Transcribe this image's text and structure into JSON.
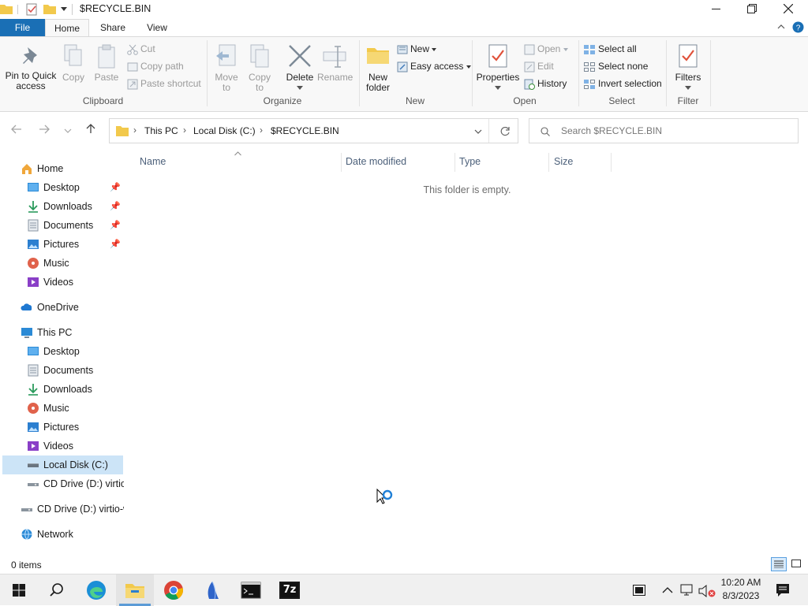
{
  "window": {
    "title": "$RECYCLE.BIN"
  },
  "ribbon_tabs": [
    "File",
    "Home",
    "Share",
    "View"
  ],
  "ribbon": {
    "clipboard": {
      "pin": [
        "Pin to Quick",
        "access"
      ],
      "copy": "Copy",
      "paste": "Paste",
      "cut": "Cut",
      "copy_path": "Copy path",
      "paste_shortcut": "Paste shortcut",
      "label": "Clipboard"
    },
    "organize": {
      "move_to": [
        "Move",
        "to"
      ],
      "copy_to": [
        "Copy",
        "to"
      ],
      "delete": "Delete",
      "rename": "Rename",
      "label": "Organize"
    },
    "new": {
      "new_folder": [
        "New",
        "folder"
      ],
      "new_item": "New",
      "easy_access": "Easy access",
      "label": "New"
    },
    "open": {
      "properties": "Properties",
      "open": "Open",
      "edit": "Edit",
      "history": "History",
      "label": "Open"
    },
    "select": {
      "select_all": "Select all",
      "select_none": "Select none",
      "invert": "Invert selection",
      "label": "Select"
    },
    "filter": {
      "filters": "Filters",
      "label": "Filter"
    }
  },
  "address": {
    "crumbs": [
      "This PC",
      "Local Disk (C:)",
      "$RECYCLE.BIN"
    ]
  },
  "search": {
    "placeholder": "Search $RECYCLE.BIN"
  },
  "nav": {
    "home": "Home",
    "quick": [
      {
        "label": "Desktop",
        "icon": "desktop-icon"
      },
      {
        "label": "Downloads",
        "icon": "downloads-icon"
      },
      {
        "label": "Documents",
        "icon": "documents-icon"
      },
      {
        "label": "Pictures",
        "icon": "pictures-icon"
      },
      {
        "label": "Music",
        "icon": "music-icon"
      },
      {
        "label": "Videos",
        "icon": "videos-icon"
      }
    ],
    "onedrive": "OneDrive",
    "thispc": "This PC",
    "pc_items": [
      {
        "label": "Desktop",
        "icon": "desktop-icon"
      },
      {
        "label": "Documents",
        "icon": "documents-icon"
      },
      {
        "label": "Downloads",
        "icon": "downloads-icon"
      },
      {
        "label": "Music",
        "icon": "music-icon"
      },
      {
        "label": "Pictures",
        "icon": "pictures-icon"
      },
      {
        "label": "Videos",
        "icon": "videos-icon"
      },
      {
        "label": "Local Disk (C:)",
        "icon": "drive-icon"
      },
      {
        "label": "CD Drive (D:) virtio-",
        "icon": "cd-drive-icon"
      }
    ],
    "cd_drive": "CD Drive (D:) virtio-w",
    "network": "Network"
  },
  "columns": [
    "Name",
    "Date modified",
    "Type",
    "Size"
  ],
  "empty_message": "This folder is empty.",
  "status": {
    "items": "0 items"
  },
  "taskbar": {
    "time": "10:20 AM",
    "date": "8/3/2023",
    "icon_7z": "7z"
  },
  "colors": {
    "accent": "#1a6fb5",
    "selection": "#cce4f7"
  }
}
